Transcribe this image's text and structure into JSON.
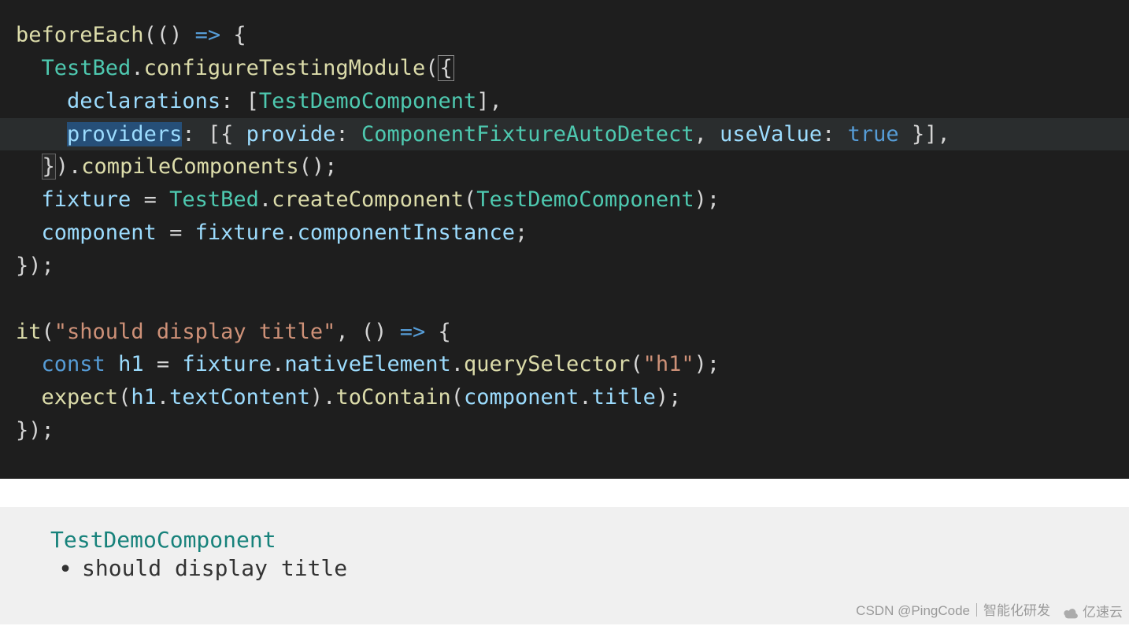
{
  "code": {
    "lines": [
      {
        "indent": 0,
        "tokens": [
          {
            "t": "beforeEach",
            "c": "tk-fn"
          },
          {
            "t": "(() ",
            "c": "tk-punc"
          },
          {
            "t": "=>",
            "c": "tk-key"
          },
          {
            "t": " {",
            "c": "tk-punc"
          }
        ]
      },
      {
        "indent": 1,
        "tokens": [
          {
            "t": "TestBed",
            "c": "tk-type"
          },
          {
            "t": ".",
            "c": "tk-punc"
          },
          {
            "t": "configureTestingModule",
            "c": "tk-fn"
          },
          {
            "t": "(",
            "c": "tk-punc"
          },
          {
            "t": "{",
            "c": "tk-punc cursor-box"
          }
        ]
      },
      {
        "indent": 2,
        "tokens": [
          {
            "t": "declarations",
            "c": "tk-var"
          },
          {
            "t": ": [",
            "c": "tk-punc"
          },
          {
            "t": "TestDemoComponent",
            "c": "tk-type"
          },
          {
            "t": "],",
            "c": "tk-punc"
          }
        ]
      },
      {
        "indent": 2,
        "highlight": true,
        "tokens": [
          {
            "t": "providers",
            "c": "tk-var sel"
          },
          {
            "t": ": [{ ",
            "c": "tk-punc"
          },
          {
            "t": "provide",
            "c": "tk-var"
          },
          {
            "t": ": ",
            "c": "tk-punc"
          },
          {
            "t": "ComponentFixtureAutoDetect",
            "c": "tk-type"
          },
          {
            "t": ", ",
            "c": "tk-punc"
          },
          {
            "t": "useValue",
            "c": "tk-var"
          },
          {
            "t": ": ",
            "c": "tk-punc"
          },
          {
            "t": "true",
            "c": "tk-key"
          },
          {
            "t": " }],",
            "c": "tk-punc"
          }
        ]
      },
      {
        "indent": 1,
        "tokens": [
          {
            "t": "}",
            "c": "tk-punc bracket-match"
          },
          {
            "t": ").",
            "c": "tk-punc"
          },
          {
            "t": "compileComponents",
            "c": "tk-fn"
          },
          {
            "t": "();",
            "c": "tk-punc"
          }
        ]
      },
      {
        "indent": 1,
        "tokens": [
          {
            "t": "fixture",
            "c": "tk-var"
          },
          {
            "t": " = ",
            "c": "tk-punc"
          },
          {
            "t": "TestBed",
            "c": "tk-type"
          },
          {
            "t": ".",
            "c": "tk-punc"
          },
          {
            "t": "createComponent",
            "c": "tk-fn"
          },
          {
            "t": "(",
            "c": "tk-punc"
          },
          {
            "t": "TestDemoComponent",
            "c": "tk-type"
          },
          {
            "t": ");",
            "c": "tk-punc"
          }
        ]
      },
      {
        "indent": 1,
        "tokens": [
          {
            "t": "component",
            "c": "tk-var"
          },
          {
            "t": " = ",
            "c": "tk-punc"
          },
          {
            "t": "fixture",
            "c": "tk-var"
          },
          {
            "t": ".",
            "c": "tk-punc"
          },
          {
            "t": "componentInstance",
            "c": "tk-var"
          },
          {
            "t": ";",
            "c": "tk-punc"
          }
        ]
      },
      {
        "indent": 0,
        "tokens": [
          {
            "t": "});",
            "c": "tk-punc"
          }
        ]
      },
      {
        "indent": 0,
        "blank": true,
        "tokens": []
      },
      {
        "indent": 0,
        "tokens": [
          {
            "t": "it",
            "c": "tk-fn"
          },
          {
            "t": "(",
            "c": "tk-punc"
          },
          {
            "t": "\"should display title\"",
            "c": "tk-str"
          },
          {
            "t": ", () ",
            "c": "tk-punc"
          },
          {
            "t": "=>",
            "c": "tk-key"
          },
          {
            "t": " {",
            "c": "tk-punc"
          }
        ]
      },
      {
        "indent": 1,
        "tokens": [
          {
            "t": "const",
            "c": "tk-key"
          },
          {
            "t": " ",
            "c": "tk-punc"
          },
          {
            "t": "h1",
            "c": "tk-var"
          },
          {
            "t": " = ",
            "c": "tk-punc"
          },
          {
            "t": "fixture",
            "c": "tk-var"
          },
          {
            "t": ".",
            "c": "tk-punc"
          },
          {
            "t": "nativeElement",
            "c": "tk-var"
          },
          {
            "t": ".",
            "c": "tk-punc"
          },
          {
            "t": "querySelector",
            "c": "tk-fn"
          },
          {
            "t": "(",
            "c": "tk-punc"
          },
          {
            "t": "\"h1\"",
            "c": "tk-str"
          },
          {
            "t": ");",
            "c": "tk-punc"
          }
        ]
      },
      {
        "indent": 1,
        "tokens": [
          {
            "t": "expect",
            "c": "tk-fn"
          },
          {
            "t": "(",
            "c": "tk-punc"
          },
          {
            "t": "h1",
            "c": "tk-var"
          },
          {
            "t": ".",
            "c": "tk-punc"
          },
          {
            "t": "textContent",
            "c": "tk-var"
          },
          {
            "t": ").",
            "c": "tk-punc"
          },
          {
            "t": "toContain",
            "c": "tk-fn"
          },
          {
            "t": "(",
            "c": "tk-punc"
          },
          {
            "t": "component",
            "c": "tk-var"
          },
          {
            "t": ".",
            "c": "tk-punc"
          },
          {
            "t": "title",
            "c": "tk-var"
          },
          {
            "t": ");",
            "c": "tk-punc"
          }
        ]
      },
      {
        "indent": 0,
        "tokens": [
          {
            "t": "});",
            "c": "tk-punc"
          }
        ]
      }
    ]
  },
  "testOutput": {
    "suite": "TestDemoComponent",
    "item": "should display title"
  },
  "watermark": {
    "left": "CSDN @PingCode｜智能化研发",
    "right": "亿速云"
  }
}
